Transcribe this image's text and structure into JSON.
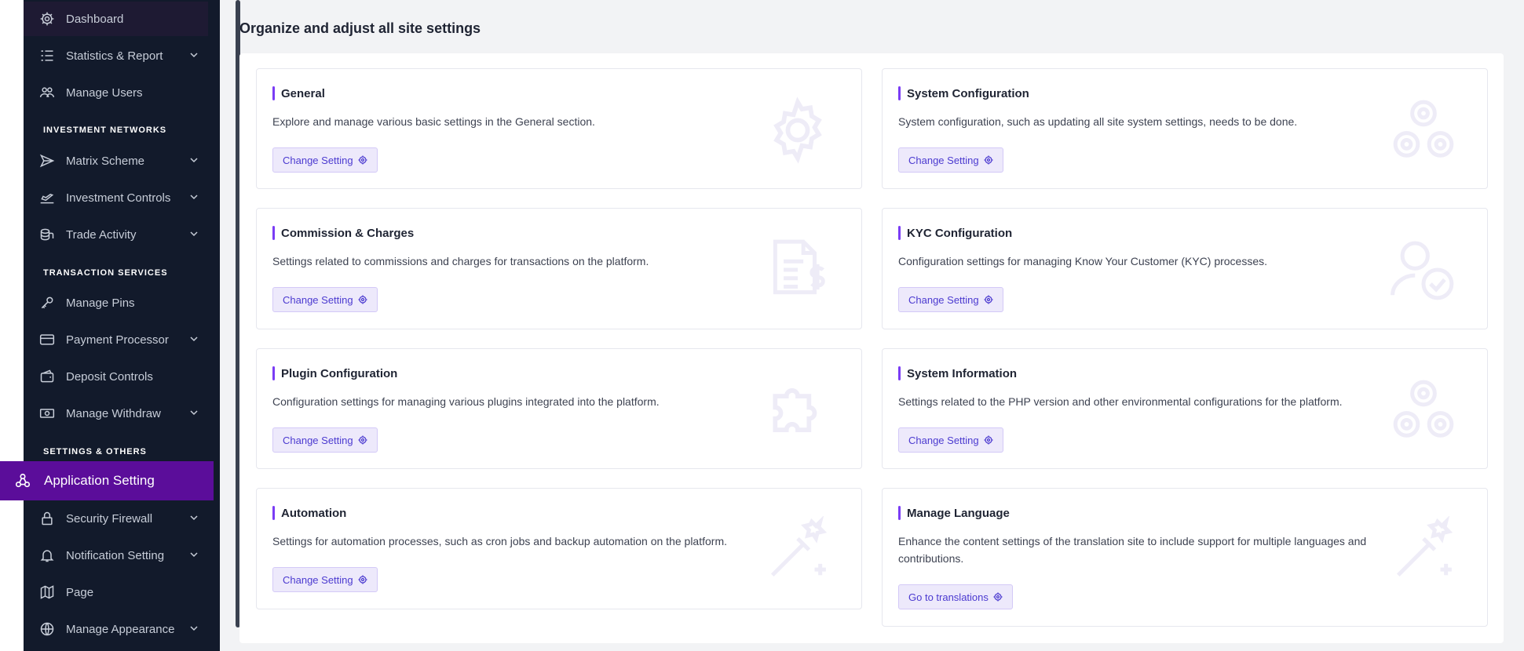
{
  "sidebar": {
    "dashboard": "Dashboard",
    "statistics": "Statistics & Report",
    "manage_users": "Manage Users",
    "section_investment": "INVESTMENT NETWORKS",
    "matrix_scheme": "Matrix Scheme",
    "investment_controls": "Investment Controls",
    "trade_activity": "Trade Activity",
    "section_transaction": "TRANSACTION SERVICES",
    "manage_pins": "Manage Pins",
    "payment_processor": "Payment Processor",
    "deposit_controls": "Deposit Controls",
    "manage_withdraw": "Manage Withdraw",
    "section_settings": "SETTINGS & OTHERS",
    "application_setting": "Application Setting",
    "security_firewall": "Security Firewall",
    "notification_setting": "Notification Setting",
    "page": "Page",
    "manage_appearance": "Manage Appearance"
  },
  "main": {
    "title": "Organize and adjust all site settings"
  },
  "cards": [
    {
      "title": "General",
      "desc": "Explore and manage various basic settings in the General section.",
      "button": "Change Setting",
      "icon": "gear-icon"
    },
    {
      "title": "System Configuration",
      "desc": "System configuration, such as updating all site system settings, needs to be done.",
      "button": "Change Setting",
      "icon": "gears-icon"
    },
    {
      "title": "Commission & Charges",
      "desc": "Settings related to commissions and charges for transactions on the platform.",
      "button": "Change Setting",
      "icon": "invoice-dollar-icon"
    },
    {
      "title": "KYC Configuration",
      "desc": "Configuration settings for managing Know Your Customer (KYC) processes.",
      "button": "Change Setting",
      "icon": "user-check-icon"
    },
    {
      "title": "Plugin Configuration",
      "desc": "Configuration settings for managing various plugins integrated into the platform.",
      "button": "Change Setting",
      "icon": "puzzle-icon"
    },
    {
      "title": "System Information",
      "desc": "Settings related to the PHP version and other environmental configurations for the platform.",
      "button": "Change Setting",
      "icon": "gears-icon"
    },
    {
      "title": "Automation",
      "desc": "Settings for automation processes, such as cron jobs and backup automation on the platform.",
      "button": "Change Setting",
      "icon": "magic-wand-icon"
    },
    {
      "title": "Manage Language",
      "desc": "Enhance the content settings of the translation site to include support for multiple languages and contributions.",
      "button": "Go to translations",
      "icon": "magic-wand-icon"
    }
  ],
  "colors": {
    "sidebar_bg": "#121a2b",
    "active_bg": "#5b0d9a",
    "accent": "#7a3cf5",
    "button_bg": "#ede9fb"
  }
}
